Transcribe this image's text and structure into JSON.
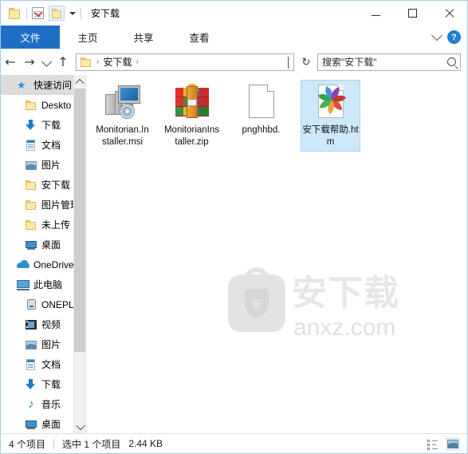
{
  "window": {
    "title": "安下载",
    "quick_access_toolbar": [
      {
        "name": "folder-icon",
        "label": ""
      },
      {
        "name": "properties-icon",
        "label": ""
      },
      {
        "name": "new-folder-icon",
        "label": ""
      },
      {
        "name": "customize-caret-icon",
        "label": ""
      }
    ],
    "controls": {
      "minimize": "—",
      "maximize": "□",
      "close": "✕"
    }
  },
  "ribbon": {
    "tabs": [
      {
        "label": "文件",
        "active": true
      },
      {
        "label": "主页",
        "active": false
      },
      {
        "label": "共享",
        "active": false
      },
      {
        "label": "查看",
        "active": false
      }
    ],
    "expand_icon": "chevron-down-icon",
    "help_label": "?"
  },
  "navigation": {
    "back": "←",
    "forward": "→",
    "recent": "⌄",
    "up": "↑",
    "address": {
      "folder_icon": "folder-icon",
      "crumbs": [
        "安下载"
      ],
      "separator": "›",
      "dropdown_icon": "chevron-down-icon"
    },
    "refresh": "↻",
    "search": {
      "placeholder": "搜索\"安下载\"",
      "value": "",
      "icon": "search-icon"
    }
  },
  "sidebar": {
    "items": [
      {
        "label": "快速访问",
        "icon": "star-pin-icon",
        "level": 0,
        "selected": true,
        "pinned": false
      },
      {
        "label": "Deskto",
        "icon": "folder-icon",
        "level": 1,
        "selected": false,
        "pinned": true
      },
      {
        "label": "下载",
        "icon": "download-icon",
        "level": 1,
        "selected": false,
        "pinned": true
      },
      {
        "label": "文档",
        "icon": "document-icon",
        "level": 1,
        "selected": false,
        "pinned": true
      },
      {
        "label": "图片",
        "icon": "picture-icon",
        "level": 1,
        "selected": false,
        "pinned": true
      },
      {
        "label": "安下载",
        "icon": "folder-icon",
        "level": 1,
        "selected": false,
        "pinned": false
      },
      {
        "label": "图片管理器",
        "icon": "folder-icon",
        "level": 1,
        "selected": false,
        "pinned": false
      },
      {
        "label": "未上传",
        "icon": "folder-icon",
        "level": 1,
        "selected": false,
        "pinned": false
      },
      {
        "label": "桌面",
        "icon": "desktop-icon",
        "level": 1,
        "selected": false,
        "pinned": false
      },
      {
        "label": "OneDrive",
        "icon": "cloud-icon",
        "level": 0,
        "selected": false,
        "pinned": false
      },
      {
        "label": "此电脑",
        "icon": "pc-icon",
        "level": 0,
        "selected": false,
        "pinned": false
      },
      {
        "label": "ONEPLUS",
        "icon": "phone-icon",
        "level": 1,
        "selected": false,
        "pinned": false
      },
      {
        "label": "视频",
        "icon": "video-icon",
        "level": 1,
        "selected": false,
        "pinned": false
      },
      {
        "label": "图片",
        "icon": "picture-icon",
        "level": 1,
        "selected": false,
        "pinned": false
      },
      {
        "label": "文档",
        "icon": "document-icon",
        "level": 1,
        "selected": false,
        "pinned": false
      },
      {
        "label": "下载",
        "icon": "download-icon",
        "level": 1,
        "selected": false,
        "pinned": false
      },
      {
        "label": "音乐",
        "icon": "music-icon",
        "level": 1,
        "selected": false,
        "pinned": false
      },
      {
        "label": "桌面",
        "icon": "desktop-icon",
        "level": 1,
        "selected": false,
        "pinned": false
      }
    ],
    "pin_glyph": "📌",
    "scroll_up": "⌃",
    "scroll_down": "⌄"
  },
  "files": [
    {
      "name": "Monitorian.Installer.msi",
      "icon": "msi-installer-icon",
      "selected": false
    },
    {
      "name": "MonitorianInstaller.zip",
      "icon": "zip-archive-icon",
      "selected": false
    },
    {
      "name": "pnghhbd.",
      "icon": "blank-file-icon",
      "selected": false
    },
    {
      "name": "安下载帮助.htm",
      "icon": "html-file-icon",
      "selected": true
    }
  ],
  "watermark": {
    "chinese": "安下载",
    "url": "anxz.com",
    "badge_char": "安"
  },
  "statusbar": {
    "item_count": "4 个项目",
    "selection": "选中 1 个项目",
    "size": "2.44 KB",
    "views": [
      {
        "name": "details-view-button",
        "active": false
      },
      {
        "name": "thumbnails-view-button",
        "active": true
      }
    ]
  },
  "colors": {
    "accent": "#1e6fc4",
    "selection_fill": "#cce8f9",
    "selection_border": "#a8d4ef",
    "window_border": "#9ecbe8",
    "sidebar_selected": "#dcdcdc"
  }
}
